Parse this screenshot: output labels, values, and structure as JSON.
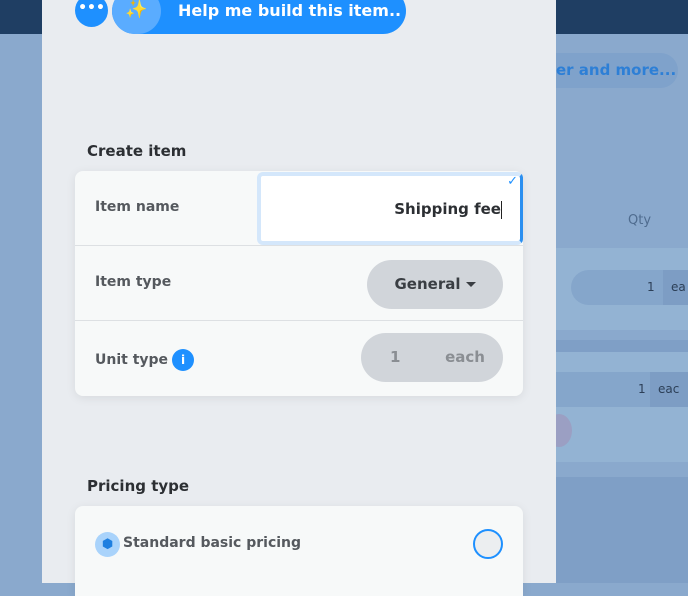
{
  "background": {
    "promo_button": "er and more...",
    "column_header": "Qty",
    "rows": [
      {
        "qty": "1",
        "unit": "ea"
      },
      {
        "qty": "1",
        "unit": "eac"
      }
    ]
  },
  "toolbar": {
    "more_icon": "more-horizontal-icon",
    "helper_label": "Help me build this item..",
    "helper_icon": "magic-wand-icon"
  },
  "create_item": {
    "heading": "Create item",
    "item_name": {
      "label": "Item name",
      "value": "Shipping fee"
    },
    "item_type": {
      "label": "Item type",
      "value": "General"
    },
    "unit_type": {
      "label": "Unit type",
      "quantity": "1",
      "unit": "each",
      "info_icon": "i"
    }
  },
  "pricing_type": {
    "heading": "Pricing type",
    "options": [
      {
        "label": "Standard basic pricing",
        "icon": "cube-icon",
        "selected": false
      }
    ]
  },
  "colors": {
    "accent": "#1e90ff",
    "panel": "#e9ecf0",
    "overlay": "#8aa9cd",
    "topbar": "#1f3e63"
  }
}
